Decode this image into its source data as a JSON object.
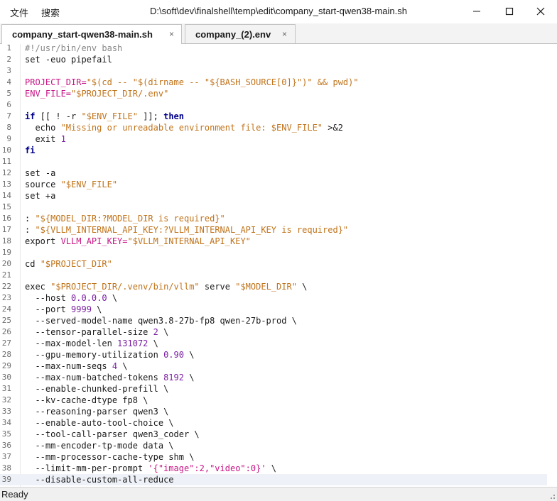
{
  "window": {
    "title": "D:\\soft\\dev\\finalshell\\temp\\edit\\company_start-qwen38-main.sh",
    "menu": [
      "文件",
      "搜索"
    ]
  },
  "tabs": [
    {
      "label": "company_start-qwen38-main.sh",
      "active": true
    },
    {
      "label": "company_(2).env",
      "active": false
    }
  ],
  "close_glyph": "×",
  "editor": {
    "current_line": 39,
    "lines": [
      [
        [
          "#!/usr/bin/env bash",
          "comment"
        ]
      ],
      [
        [
          "set -euo pipefail",
          ""
        ]
      ],
      [],
      [
        [
          "PROJECT_DIR=",
          "var"
        ],
        [
          "\"$(cd -- \"$(dirname -- \"${BASH_SOURCE[0]}\")\" && pwd)\"",
          "str"
        ]
      ],
      [
        [
          "ENV_FILE=",
          "var"
        ],
        [
          "\"$PROJECT_DIR/.env\"",
          "str"
        ]
      ],
      [],
      [
        [
          "if",
          "kw"
        ],
        [
          " [[ ! -r ",
          ""
        ],
        [
          "\"$ENV_FILE\"",
          "str"
        ],
        [
          " ]]; ",
          ""
        ],
        [
          "then",
          "kw"
        ]
      ],
      [
        [
          "  echo ",
          ""
        ],
        [
          "\"Missing or unreadable environment file: $ENV_FILE\"",
          "str"
        ],
        [
          " >&2",
          ""
        ]
      ],
      [
        [
          "  exit ",
          ""
        ],
        [
          "1",
          "num"
        ]
      ],
      [
        [
          "fi",
          "kw"
        ]
      ],
      [],
      [
        [
          "set -a",
          ""
        ]
      ],
      [
        [
          "source ",
          ""
        ],
        [
          "\"$ENV_FILE\"",
          "str"
        ]
      ],
      [
        [
          "set +a",
          ""
        ]
      ],
      [],
      [
        [
          ": ",
          ""
        ],
        [
          "\"${MODEL_DIR:?MODEL_DIR is required}\"",
          "str"
        ]
      ],
      [
        [
          ": ",
          ""
        ],
        [
          "\"${VLLM_INTERNAL_API_KEY:?VLLM_INTERNAL_API_KEY is required}\"",
          "str"
        ]
      ],
      [
        [
          "export ",
          ""
        ],
        [
          "VLLM_API_KEY=",
          "var"
        ],
        [
          "\"$VLLM_INTERNAL_API_KEY\"",
          "str"
        ]
      ],
      [],
      [
        [
          "cd ",
          ""
        ],
        [
          "\"$PROJECT_DIR\"",
          "str"
        ]
      ],
      [],
      [
        [
          "exec ",
          ""
        ],
        [
          "\"$PROJECT_DIR/.venv/bin/vllm\"",
          "str"
        ],
        [
          " serve ",
          ""
        ],
        [
          "\"$MODEL_DIR\"",
          "str"
        ],
        [
          " \\",
          ""
        ]
      ],
      [
        [
          "  --host ",
          ""
        ],
        [
          "0.0.0.0",
          "num"
        ],
        [
          " \\",
          ""
        ]
      ],
      [
        [
          "  --port ",
          ""
        ],
        [
          "9999",
          "num"
        ],
        [
          " \\",
          ""
        ]
      ],
      [
        [
          "  --served-model-name qwen3.8-27b-fp8 qwen-27b-prod \\",
          ""
        ]
      ],
      [
        [
          "  --tensor-parallel-size ",
          ""
        ],
        [
          "2",
          "num"
        ],
        [
          " \\",
          ""
        ]
      ],
      [
        [
          "  --max-model-len ",
          ""
        ],
        [
          "131072",
          "num"
        ],
        [
          " \\",
          ""
        ]
      ],
      [
        [
          "  --gpu-memory-utilization ",
          ""
        ],
        [
          "0.90",
          "num"
        ],
        [
          " \\",
          ""
        ]
      ],
      [
        [
          "  --max-num-seqs ",
          ""
        ],
        [
          "4",
          "num"
        ],
        [
          " \\",
          ""
        ]
      ],
      [
        [
          "  --max-num-batched-tokens ",
          ""
        ],
        [
          "8192",
          "num"
        ],
        [
          " \\",
          ""
        ]
      ],
      [
        [
          "  --enable-chunked-prefill \\",
          ""
        ]
      ],
      [
        [
          "  --kv-cache-dtype fp8 \\",
          ""
        ]
      ],
      [
        [
          "  --reasoning-parser qwen3 \\",
          ""
        ]
      ],
      [
        [
          "  --enable-auto-tool-choice \\",
          ""
        ]
      ],
      [
        [
          "  --tool-call-parser qwen3_coder \\",
          ""
        ]
      ],
      [
        [
          "  --mm-encoder-tp-mode data \\",
          ""
        ]
      ],
      [
        [
          "  --mm-processor-cache-type shm \\",
          ""
        ]
      ],
      [
        [
          "  --limit-mm-per-prompt ",
          ""
        ],
        [
          "'{\"image\":2,\"video\":0}'",
          "var"
        ],
        [
          " \\",
          ""
        ]
      ],
      [
        [
          "  --disable-custom-all-reduce",
          ""
        ]
      ]
    ]
  },
  "status": {
    "text": "Ready"
  }
}
